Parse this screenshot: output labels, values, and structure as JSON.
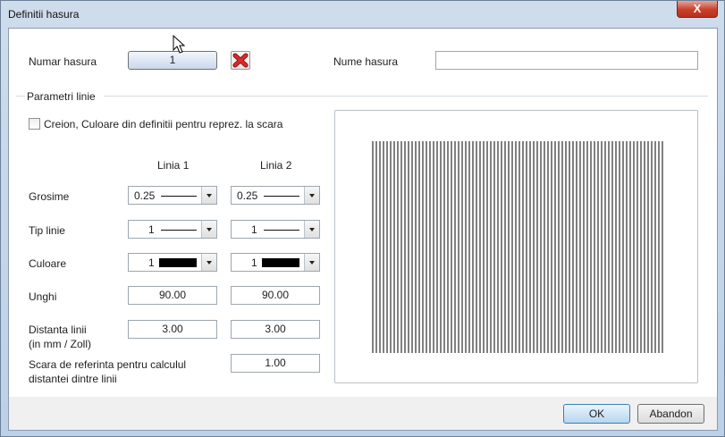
{
  "window": {
    "title": "Definitii hasura",
    "close_glyph": "X"
  },
  "hatch_number": {
    "label": "Numar hasura",
    "value": "1",
    "delete_icon": "red-x-icon"
  },
  "hatch_name": {
    "label": "Nume hasura",
    "value": ""
  },
  "line_params": {
    "group_label": "Parametri linie",
    "checkbox_label": "Creion, Culoare din definitii pentru reprez. la scara",
    "checkbox_checked": false,
    "col1_header": "Linia 1",
    "col2_header": "Linia 2",
    "thickness": {
      "label": "Grosime",
      "line1": "0.25",
      "line2": "0.25"
    },
    "line_type": {
      "label": "Tip linie",
      "line1": "1",
      "line2": "1"
    },
    "color": {
      "label": "Culoare",
      "line1": "1",
      "line2": "1",
      "swatch": "#000000"
    },
    "angle": {
      "label": "Unghi",
      "line1": "90.00",
      "line2": "90.00"
    },
    "distance": {
      "label_line1": "Distanta linii",
      "label_line2": "(in mm / Zoll)",
      "line1": "3.00",
      "line2": "3.00"
    },
    "ref_scale": {
      "label_line1": "Scara de referinta pentru calculul",
      "label_line2": "distantei dintre linii",
      "value": "1.00"
    }
  },
  "buttons": {
    "ok": "OK",
    "cancel": "Abandon"
  }
}
